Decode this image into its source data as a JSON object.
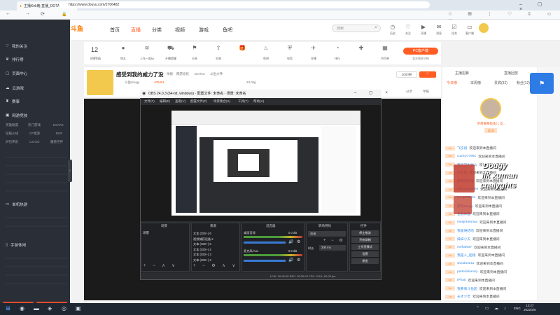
{
  "browser": {
    "tab_title": "主播Kirk晚 直播_DOTA2直播_斗",
    "url": "https://www.douyu.com/2706482"
  },
  "sidebar": {
    "items": [
      {
        "label": "我的关注"
      },
      {
        "label": "排行榜"
      },
      {
        "label": "页面中心"
      },
      {
        "label": "云游戏"
      },
      {
        "label": "赛事"
      },
      {
        "label": "网游竞技"
      },
      {
        "label": "单机热游"
      },
      {
        "label": "手游休闲"
      }
    ],
    "games_row1": [
      "英雄联盟",
      "热门游戏",
      "DOTA2"
    ],
    "games_row2": [
      "穿越火线",
      "CF端游",
      "DNF"
    ],
    "games_row3": [
      "炉石传说",
      "CS:GO",
      "魔兽世界"
    ],
    "bottom_buttons": [
      "客户端下载",
      "我要开播"
    ]
  },
  "header": {
    "logo": "斗鱼",
    "nav": [
      "首页",
      "直播",
      "分类",
      "视频",
      "游戏",
      "鱼吧"
    ],
    "search_placeholder": "搜索",
    "icons": [
      "历史",
      "关注",
      "开播",
      "消息",
      "任务",
      "客户端",
      "会员"
    ]
  },
  "toolrow": {
    "count": "12",
    "items": [
      "主播等级",
      "鱼丸",
      "上车一起玩",
      "开播提醒",
      "分享",
      "礼物",
      "鱼吧",
      "电竞",
      "开播",
      "排行",
      "节目单"
    ],
    "pc_button": "PC客户端",
    "pc_sub": "看直播更流畅"
  },
  "room": {
    "title": "感受到我的威力了没",
    "tag1": "举报",
    "tag2": "网游竞技",
    "tag3": "DOTA2",
    "tag4": "斗鱼大神",
    "anchor": "斗鱼dougy",
    "hot": "409451",
    "follow": "23.0kg",
    "follow_button": "2000粉",
    "share": "分享",
    "report": "举报"
  },
  "obs": {
    "title": "OBS 24.0.3 (64-bit, windows) - 配置文件: 未命名 - 场景: 未命名",
    "menu": [
      "文件(F)",
      "编辑(E)",
      "查看(V)",
      "配置文件(P)",
      "场景集合(S)",
      "工具(T)",
      "帮助(H)"
    ],
    "docks": [
      "场景",
      "来源",
      "混音器",
      "转场特效",
      "控件"
    ],
    "scene_item": "场景",
    "sources": [
      "文本 (GDI+) 6",
      "视频捕获设备 2",
      "文本 (GDI+) 5",
      "文本 (GDI+) 4",
      "文本 (GDI+) 3",
      "文本 (GDI+) 2"
    ],
    "mixer": [
      "桌面音频",
      "麦克风/Aux"
    ],
    "mixer_db": [
      "0.0 dB",
      "0.0 dB"
    ],
    "transition": "淡出",
    "duration_label": "时长",
    "duration": "300 ms",
    "controls": [
      "停止推流",
      "开始录制",
      "工作室模式",
      "设置",
      "退出"
    ],
    "status": "LIVE: 00:00:00   REC: 00:00:00   CPU: 0.5%, 60.00 fps"
  },
  "chat": {
    "top_tabs": [
      "主播招募",
      "直播回放"
    ],
    "tabs": [
      "今日榜",
      "本周榜",
      "贵宾(32)",
      "粉丝(12)"
    ],
    "fan_name": "罗想要那些鱼儿 女...",
    "fan_count": "10.0",
    "welcome": "欢迎来到本直播间",
    "users": [
      "飞伤很",
      "cuzmy77991",
      "宝贝又为什么",
      "别点我",
      "我来说句话",
      "wheanghanhe",
      "kong666661",
      "菜鸡dougy",
      "金融体面",
      "meignbeanaa",
      "我是谁哈哈",
      "妹妹小天",
      "meftal937",
      "我是人_超级",
      "wuodon211",
      "partedulianciy",
      "tPhatt",
      "我要来斗鱼超",
      "天才少年"
    ]
  },
  "overlay": {
    "line1": "Dougy",
    "line2": "ilk xuman",
    "line3": "cnalyghts"
  },
  "taskbar": {
    "time": "13:27",
    "date": "2022/2/5",
    "lang": "ENG"
  }
}
